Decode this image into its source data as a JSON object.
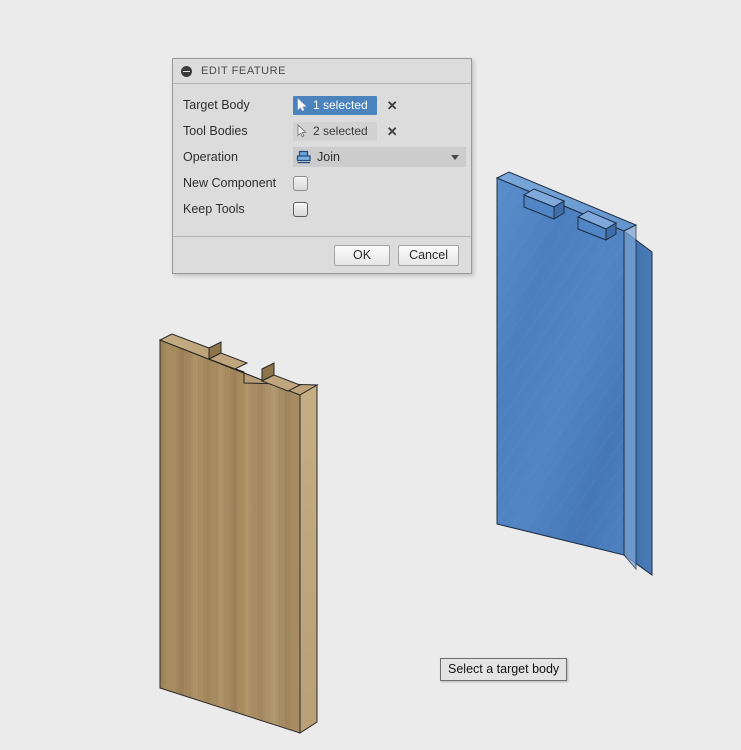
{
  "app": {
    "background_color": "#ebebeb"
  },
  "dialog": {
    "title": "EDIT FEATURE",
    "collapse_icon": "minus-circle-icon",
    "rows": {
      "target_body": {
        "label": "Target Body",
        "button_text": "1 selected",
        "button_state": "active",
        "cursor_icon": "select-cursor-icon",
        "clear_icon": "clear-x-icon",
        "clear_glyph": "✕"
      },
      "tool_bodies": {
        "label": "Tool Bodies",
        "button_text": "2 selected",
        "button_state": "idle",
        "cursor_icon": "select-cursor-icon",
        "clear_icon": "clear-x-icon",
        "clear_glyph": "✕"
      },
      "operation": {
        "label": "Operation",
        "value": "Join",
        "icon": "join-boolean-icon",
        "caret_icon": "chevron-down-icon"
      },
      "new_component": {
        "label": "New Component",
        "checked": false
      },
      "keep_tools": {
        "label": "Keep Tools",
        "checked": false
      }
    },
    "footer": {
      "ok_label": "OK",
      "cancel_label": "Cancel"
    },
    "colors": {
      "active_selection": "#4b83bd",
      "idle_selection": "#d2d2d2",
      "panel": "#dcdcdc",
      "dropdown": "#cccccc"
    }
  },
  "tooltip": {
    "text": "Select a target body"
  },
  "viewport": {
    "bodies": [
      {
        "name": "wood-panel",
        "material": "wood",
        "color": "#a88b5e",
        "edge_color": "#2c2c2c",
        "notches": 2,
        "role": "tool-body"
      },
      {
        "name": "blue-panel",
        "material": "plastic",
        "color": "#4a7ec0",
        "edge_color": "#1c2a3c",
        "tabs": 2,
        "role": "target-body"
      }
    ]
  }
}
